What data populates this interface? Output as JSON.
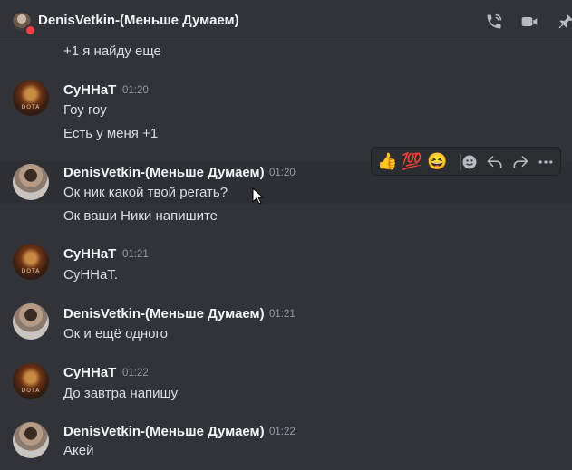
{
  "header": {
    "title": "DenisVetkin-(Меньше Думаем)",
    "icons": [
      "voice-call-icon",
      "video-call-icon",
      "pin-icon"
    ],
    "status_color": "#f23f43"
  },
  "messages": {
    "m0": {
      "text": "+1 я найду еще"
    },
    "m1": {
      "author": "СуННаТ",
      "time": "01:20",
      "lines": [
        "Гоу гоу",
        "Есть у меня +1"
      ]
    },
    "m2": {
      "author": "DenisVetkin-(Меньше Думаем)",
      "time": "01:20",
      "lines": [
        "Ок ник какой твой регать?",
        "Ок ваши Ники напишите"
      ]
    },
    "m3": {
      "author": "СуННаТ",
      "time": "01:21",
      "lines": [
        "СуННаТ."
      ]
    },
    "m4": {
      "author": "DenisVetkin-(Меньше Думаем)",
      "time": "01:21",
      "lines": [
        "Ок и ещё одного"
      ]
    },
    "m5": {
      "author": "СуННаТ",
      "time": "01:22",
      "lines": [
        "До завтра напишу"
      ]
    },
    "m6": {
      "author": "DenisVetkin-(Меньше Думаем)",
      "time": "01:22",
      "lines": [
        "Акей"
      ]
    }
  },
  "toolbar": {
    "reactions": [
      "👍",
      "💯",
      "😆"
    ],
    "actions": [
      "add-reaction-icon",
      "reply-icon",
      "forward-icon",
      "more-icon"
    ]
  }
}
